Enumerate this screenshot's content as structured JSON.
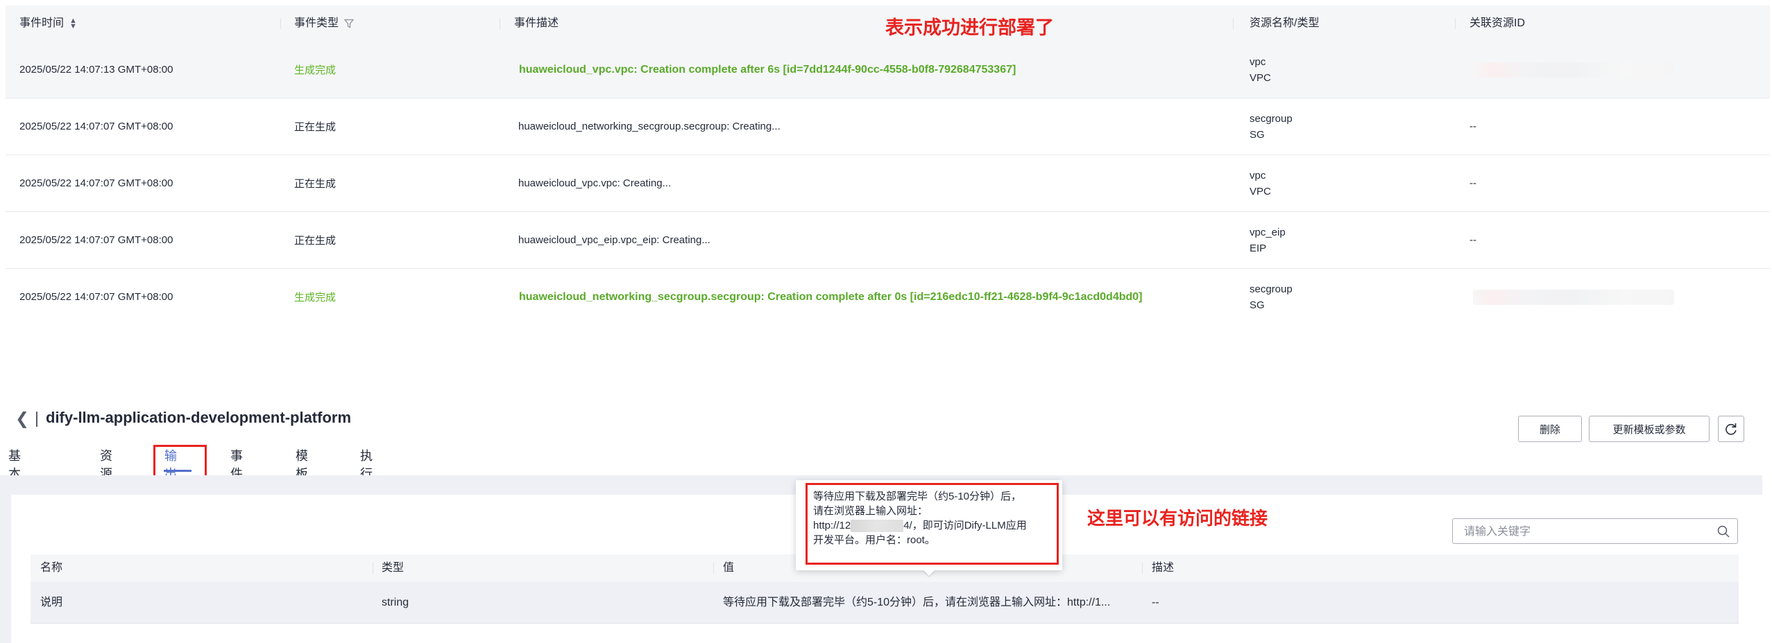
{
  "events_table": {
    "headers": {
      "time": "事件时间",
      "type": "事件类型",
      "description": "事件描述",
      "resource": "资源名称/类型",
      "resource_id": "关联资源ID"
    },
    "annotation": "表示成功进行部署了",
    "rows": [
      {
        "time": "2025/05/22 14:07:13 GMT+08:00",
        "type": "生成完成",
        "description": "huaweicloud_vpc.vpc: Creation complete after 6s [id=7dd1244f-90cc-4558-b0f8-792684753367]",
        "resource_name": "vpc",
        "resource_type": "VPC",
        "resource_id": ""
      },
      {
        "time": "2025/05/22 14:07:07 GMT+08:00",
        "type": "正在生成",
        "description": "huaweicloud_networking_secgroup.secgroup: Creating...",
        "resource_name": "secgroup",
        "resource_type": "SG",
        "resource_id": "--"
      },
      {
        "time": "2025/05/22 14:07:07 GMT+08:00",
        "type": "正在生成",
        "description": "huaweicloud_vpc.vpc: Creating...",
        "resource_name": "vpc",
        "resource_type": "VPC",
        "resource_id": "--"
      },
      {
        "time": "2025/05/22 14:07:07 GMT+08:00",
        "type": "正在生成",
        "description": "huaweicloud_vpc_eip.vpc_eip: Creating...",
        "resource_name": "vpc_eip",
        "resource_type": "EIP",
        "resource_id": "--"
      },
      {
        "time": "2025/05/22 14:07:07 GMT+08:00",
        "type": "生成完成",
        "description": "huaweicloud_networking_secgroup.secgroup: Creation complete after 0s [id=216edc10-ff21-4628-b9f4-9c1acd0d4bd0]",
        "resource_name": "secgroup",
        "resource_type": "SG",
        "resource_id": ""
      }
    ]
  },
  "detail": {
    "title": "dify-llm-application-development-platform",
    "buttons": {
      "delete": "删除",
      "update": "更新模板或参数"
    },
    "tabs": [
      "基本信息",
      "资源",
      "输出",
      "事件",
      "模板",
      "执行计划"
    ],
    "active_tab": "输出"
  },
  "output": {
    "annotation": "这里可以有访问的链接",
    "search_placeholder": "请输入关键字",
    "headers": {
      "name": "名称",
      "type": "类型",
      "value": "值",
      "description": "描述"
    },
    "row": {
      "name": "说明",
      "type": "string",
      "value": "等待应用下载及部署完毕（约5-10分钟）后，请在浏览器上输入网址：http://1...",
      "description": "--"
    },
    "tooltip": {
      "line1": "等待应用下载及部署完毕（约5-10分钟）后，",
      "line2": "请在浏览器上输入网址：",
      "line3_prefix": "http://12",
      "line3_suffix": "4/，即可访问Dify-LLM应用",
      "line4": "开发平台。用户名：root。"
    }
  },
  "colors": {
    "success_green": "#5fb526",
    "annotation_red": "#e8231f",
    "active_tab_blue": "#526ecc"
  }
}
